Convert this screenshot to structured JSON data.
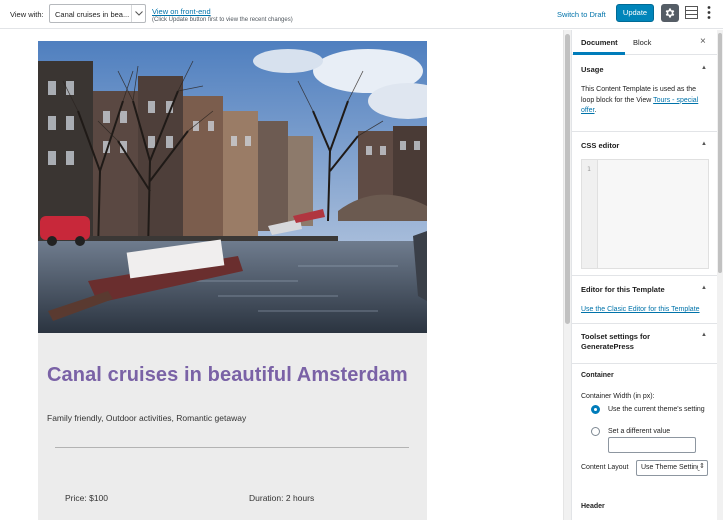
{
  "toolbar": {
    "view_with_label": "View with:",
    "view_select_value": "Canal cruises in bea...",
    "view_front_link": "View on front-end",
    "view_front_note": "(Click Update button first to view the recent changes)",
    "switch_draft": "Switch to Draft",
    "update": "Update"
  },
  "post": {
    "title": "Canal cruises in beautiful Amsterdam",
    "tags": "Family friendly, Outdoor activities, Romantic getaway",
    "price": "Price: $100",
    "duration": "Duration: 2 hours"
  },
  "sidebar": {
    "tab_document": "Document",
    "tab_block": "Block",
    "close": "×",
    "usage": {
      "title": "Usage",
      "text_before": "This Content Template is used as the loop block for the View ",
      "link": "Tours - special offer",
      "text_after": "."
    },
    "css_editor": {
      "title": "CSS editor",
      "line_number": "1"
    },
    "editor_template": {
      "title": "Editor for this Template",
      "link": "Use the Clasic Editor for this Template"
    },
    "toolset": {
      "title": "Toolset settings for GeneratePress",
      "container_label": "Container",
      "width_label": "Container Width (in px):",
      "option_current": "Use the current theme's setting",
      "option_different": "Set a different value",
      "content_layout_label": "Content Layout",
      "content_layout_value": "Use Theme Settings",
      "header_label": "Header"
    }
  },
  "colors": {
    "accent": "#0085ba",
    "link": "#0073aa",
    "title_purple": "#7a62a6"
  }
}
